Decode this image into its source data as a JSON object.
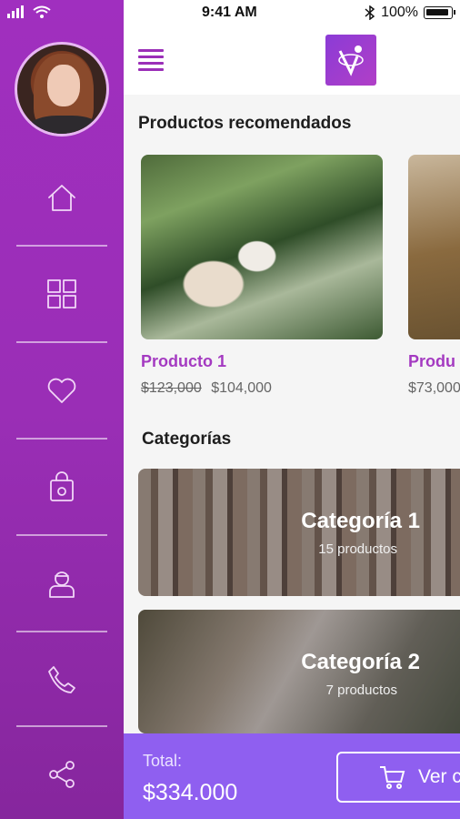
{
  "status_bar": {
    "time": "9:41 AM",
    "battery": "100%"
  },
  "sidebar": {
    "items": [
      {
        "icon": "home-icon"
      },
      {
        "icon": "grid-icon"
      },
      {
        "icon": "heart-icon"
      },
      {
        "icon": "shopping-bag-icon"
      },
      {
        "icon": "support-agent-icon"
      },
      {
        "icon": "phone-icon"
      },
      {
        "icon": "share-icon"
      }
    ]
  },
  "header": {
    "logo_icon": "brand-logo-icon"
  },
  "recommended": {
    "title": "Productos recomendados",
    "products": [
      {
        "name": "Producto 1",
        "old_price": "$123,000",
        "price": "$104,000"
      },
      {
        "name": "Produ",
        "price": "$73,000"
      }
    ]
  },
  "categories": {
    "title": "Categorías",
    "items": [
      {
        "name": "Categoría 1",
        "count": "15 productos"
      },
      {
        "name": "Categoría 2",
        "count": "7 productos"
      }
    ]
  },
  "cart": {
    "total_label": "Total:",
    "total_value": "$334.000",
    "button_label": "Ver c"
  },
  "colors": {
    "primary": "#9b2fb8",
    "accent": "#8f5ff0",
    "price_name": "#a43ac1"
  }
}
